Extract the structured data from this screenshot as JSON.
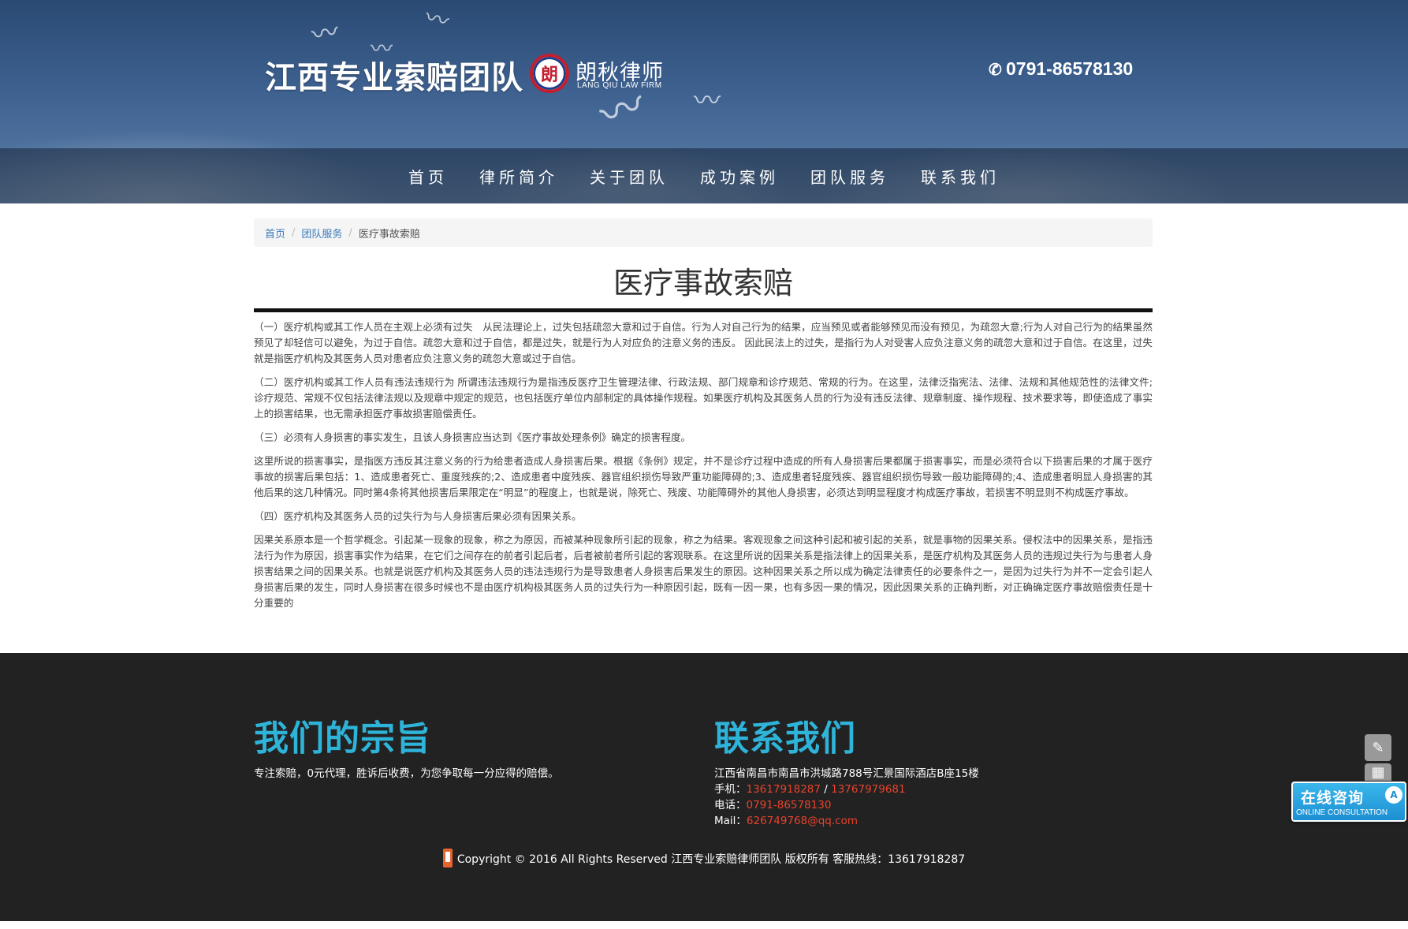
{
  "header": {
    "brand": "江西专业索赔团队",
    "firm_logo_glyph": "朗",
    "firm_name": "朗秋律师",
    "firm_name_en": "LANG QIU LAW FIRM",
    "phone_icon": "phone-icon",
    "phone": "0791-86578130"
  },
  "nav": {
    "items": [
      {
        "label": "首页"
      },
      {
        "label": "律所简介"
      },
      {
        "label": "关于团队"
      },
      {
        "label": "成功案例"
      },
      {
        "label": "团队服务"
      },
      {
        "label": "联系我们"
      }
    ]
  },
  "breadcrumb": {
    "home": "首页",
    "section": "团队服务",
    "current": "医疗事故索赔",
    "separator": "/"
  },
  "article": {
    "title": "医疗事故索赔",
    "paragraphs": [
      "（一）医疗机构或其工作人员在主观上必须有过失　从民法理论上，过失包括疏忽大意和过于自信。行为人对自己行为的结果，应当预见或者能够预见而没有预见，为疏忽大意;行为人对自己行为的结果虽然预见了却轻信可以避免，为过于自信。疏忽大意和过于自信，都是过失，就是行为人对应负的注意义务的违反。 因此民法上的过失，是指行为人对受害人应负注意义务的疏忽大意和过于自信。在这里，过失就是指医疗机构及其医务人员对患者应负注意义务的疏忽大意或过于自信。",
      "（二）医疗机构或其工作人员有违法违规行为 所谓违法违规行为是指违反医疗卫生管理法律、行政法规、部门规章和诊疗规范、常规的行为。在这里，法律泛指宪法、法律、法规和其他规范性的法律文件;诊疗规范、常规不仅包括法律法规以及规章中规定的规范，也包括医疗单位内部制定的具体操作规程。如果医疗机构及其医务人员的行为没有违反法律、规章制度、操作规程、技术要求等，即使造成了事实上的损害结果，也无需承担医疗事故损害赔偿责任。",
      "（三）必须有人身损害的事实发生，且该人身损害应当达到《医疗事故处理条例》确定的损害程度。",
      "这里所说的损害事实，是指医方违反其注意义务的行为给患者造成人身损害后果。根据《条例》规定，并不是诊疗过程中造成的所有人身损害后果都属于损害事实，而是必须符合以下损害后果的才属于医疗事故的损害后果包括：1、造成患者死亡、重度残疾的;2、造成患者中度残疾、器官组织损伤导致严重功能障碍的;3、造成患者轻度残疾、器官组织损伤导致一般功能障碍的;4、造成患者明显人身损害的其他后果的这几种情况。同时第4条将其他损害后果限定在“明显”的程度上，也就是说，除死亡、残废、功能障碍外的其他人身损害，必须达到明显程度才构成医疗事故，若损害不明显则不构成医疗事故。",
      "（四）医疗机构及其医务人员的过失行为与人身损害后果必须有因果关系。",
      "因果关系原本是一个哲学概念。引起某一现象的现象，称之为原因，而被某种现象所引起的现象，称之为结果。客观现象之间这种引起和被引起的关系，就是事物的因果关系。侵权法中的因果关系，是指违法行为作为原因，损害事实作为结果，在它们之间存在的前者引起后者，后者被前者所引起的客观联系。在这里所说的因果关系是指法律上的因果关系，是医疗机构及其医务人员的违规过失行为与患者人身损害结果之间的因果关系。也就是说医疗机构及其医务人员的违法违规行为是导致患者人身损害后果发生的原因。这种因果关系之所以成为确定法律责任的必要条件之一，是因为过失行为并不一定会引起人身损害后果的发生，同时人身损害在很多时候也不是由医疗机构极其医务人员的过失行为一种原因引起，既有一因一果，也有多因一果的情况，因此因果关系的正确判断，对正确确定医疗事故赔偿责任是十分重要的"
    ]
  },
  "footer": {
    "mission_heading": "我们的宗旨",
    "mission_text": "专注索赔，0元代理，胜诉后收费，为您争取每一分应得的赔偿。",
    "contact_heading": "联系我们",
    "address": "江西省南昌市南昌市洪城路788号汇景国际酒店B座15楼",
    "mobile_label": "手机：",
    "mobile_1": "13617918287",
    "mobile_sep": " / ",
    "mobile_2": "13767979681",
    "tel_label": "电话：",
    "tel": "0791-86578130",
    "mail_label": "Mail：",
    "mail": "626749768@qq.com",
    "copyright": "Copyright © 2016 All Rights Reserved 江西专业索赔律师团队 版权所有 客服热线：13617918287"
  },
  "floating": {
    "edit_icon": "pencil-icon",
    "qr_icon": "qrcode-icon",
    "consult_cn": "在线咨询",
    "consult_en": "ONLINE CONSULTATION",
    "consult_bubble": "A"
  },
  "colors": {
    "accent_cyan": "#2fb4d9",
    "link_red": "#e8432e",
    "link_blue": "#3a7ab8",
    "footer_bg": "#222222",
    "consult_blue": "#1c8fd2"
  }
}
